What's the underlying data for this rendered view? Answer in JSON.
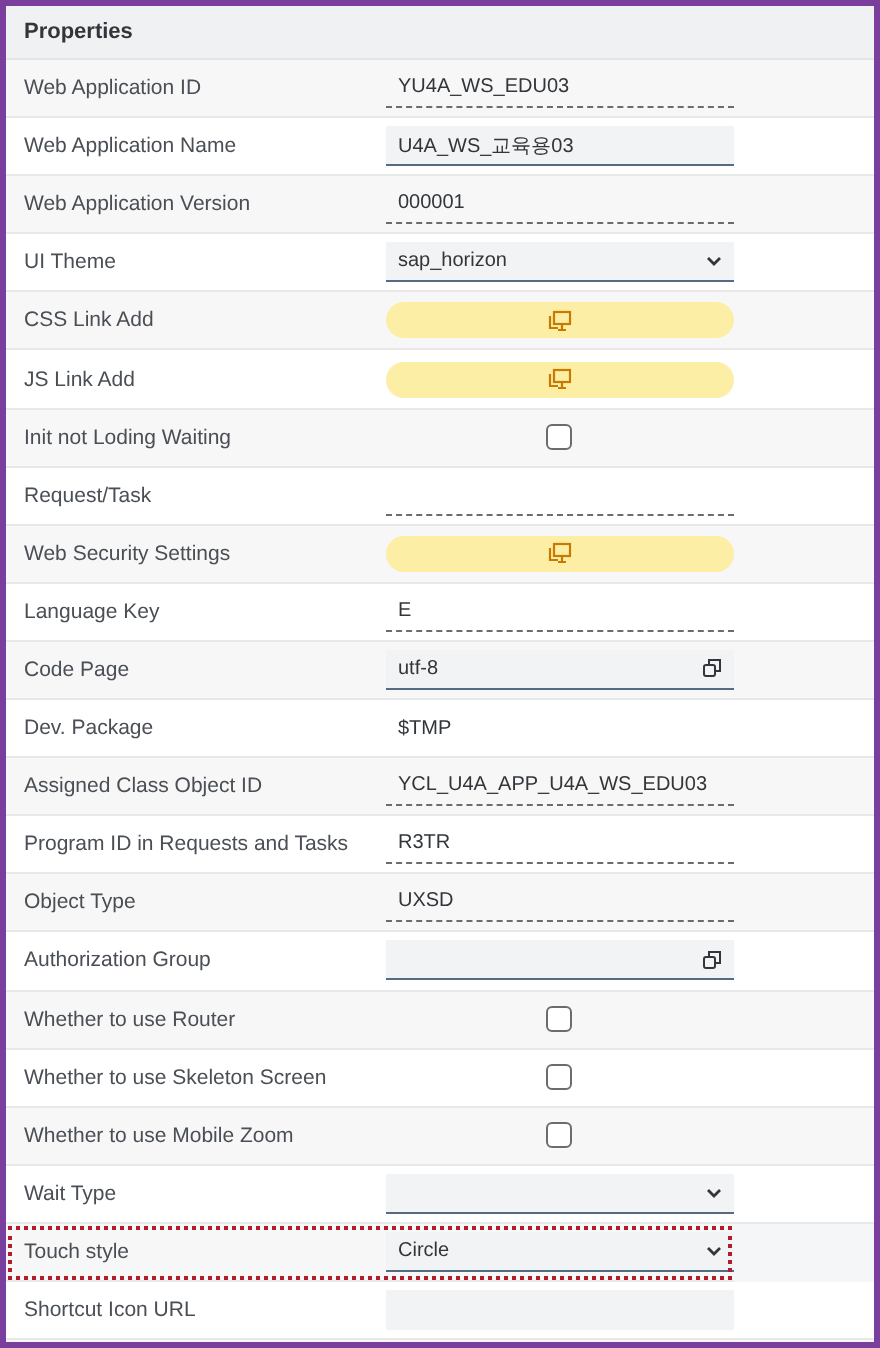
{
  "panel": {
    "title": "Properties"
  },
  "rows": [
    {
      "label": "Web Application ID",
      "kind": "readonly",
      "value": "YU4A_WS_EDU03",
      "highlighted": false
    },
    {
      "label": "Web Application Name",
      "kind": "input",
      "value": "U4A_WS_교육용03",
      "highlighted": false
    },
    {
      "label": "Web Application Version",
      "kind": "readonly",
      "value": "000001",
      "highlighted": false
    },
    {
      "label": "UI Theme",
      "kind": "select",
      "value": "sap_horizon",
      "highlighted": false
    },
    {
      "label": "CSS Link Add",
      "kind": "button",
      "highlighted": false
    },
    {
      "label": "JS Link Add",
      "kind": "button",
      "highlighted": false
    },
    {
      "label": "Init not Loding Waiting",
      "kind": "checkbox",
      "checked": false,
      "highlighted": false
    },
    {
      "label": "Request/Task",
      "kind": "readonly",
      "highlighted": false
    },
    {
      "label": "Web Security Settings",
      "kind": "button",
      "highlighted": false
    },
    {
      "label": "Language Key",
      "kind": "readonly",
      "value": "E",
      "highlighted": false
    },
    {
      "label": "Code Page",
      "kind": "valuehelp",
      "value": "utf-8",
      "highlighted": false
    },
    {
      "label": "Dev. Package",
      "kind": "text",
      "value": "$TMP",
      "highlighted": false
    },
    {
      "label": "Assigned Class Object ID",
      "kind": "readonly",
      "value": "YCL_U4A_APP_U4A_WS_EDU03",
      "highlighted": false
    },
    {
      "label": "Program ID in Requests and Tasks",
      "kind": "readonly",
      "value": "R3TR",
      "highlighted": false
    },
    {
      "label": "Object Type",
      "kind": "readonly",
      "value": "UXSD",
      "highlighted": false
    },
    {
      "label": "Authorization Group",
      "kind": "valuehelp",
      "highlighted": false
    },
    {
      "label": "Whether to use Router",
      "kind": "checkbox",
      "checked": false,
      "highlighted": false
    },
    {
      "label": "Whether to use Skeleton Screen",
      "kind": "checkbox",
      "checked": false,
      "highlighted": false
    },
    {
      "label": "Whether to use Mobile Zoom",
      "kind": "checkbox",
      "checked": false,
      "highlighted": false
    },
    {
      "label": "Wait Type",
      "kind": "select",
      "highlighted": false
    },
    {
      "label": "Touch style",
      "kind": "select",
      "value": "Circle",
      "highlighted": true
    },
    {
      "label": "Shortcut Icon URL",
      "kind": "blank",
      "highlighted": false
    }
  ]
}
